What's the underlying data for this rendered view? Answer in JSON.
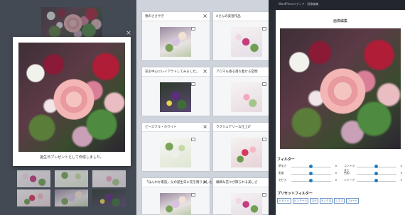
{
  "modal": {
    "caption": "誕生日プレゼントとして作成しました。",
    "close_glyph": "×"
  },
  "cards": [
    {
      "title": "春のささやき",
      "close": "×"
    },
    {
      "title": "Aさんの実習作品",
      "close": "×"
    },
    {
      "title": "花を中心にレイアウトしてみました。",
      "close": "×"
    },
    {
      "title": "アロマも香る落ち着ける空間",
      "close": "×"
    },
    {
      "title": "ピースフル・ホワイト",
      "close": "×"
    },
    {
      "title": "ラグジュアリーな仕上げ",
      "close": "×"
    },
    {
      "title": "「ほんわか家族」父の誕生日に花を贈りました。",
      "close": "×"
    },
    {
      "title": "繊細な花々が飾られる美しさ",
      "close": "×"
    }
  ],
  "right_panel": {
    "topbar_text": "WordPressメディア · 画像編集",
    "title": "画像編集",
    "filter_section": "フィルター",
    "preset_section": "プリセットフィルター",
    "left_sliders": [
      {
        "label": "明るさ",
        "value": "0",
        "level": 0.5
      },
      {
        "label": "彩度",
        "value": "0",
        "level": 0.5
      },
      {
        "label": "セピア",
        "value": "0",
        "level": 0.5
      }
    ],
    "right_sliders": [
      {
        "label": "コントラスト",
        "value": "0",
        "level": 0.5
      },
      {
        "label": "色相",
        "value": "0",
        "level": 0.5
      },
      {
        "label": "シャープ",
        "value": "0",
        "level": 0.5
      }
    ],
    "presets": [
      "ビビッド",
      "ビンテージ",
      "ロモ",
      "モノクロ",
      "シネマ",
      "フェード"
    ]
  }
}
